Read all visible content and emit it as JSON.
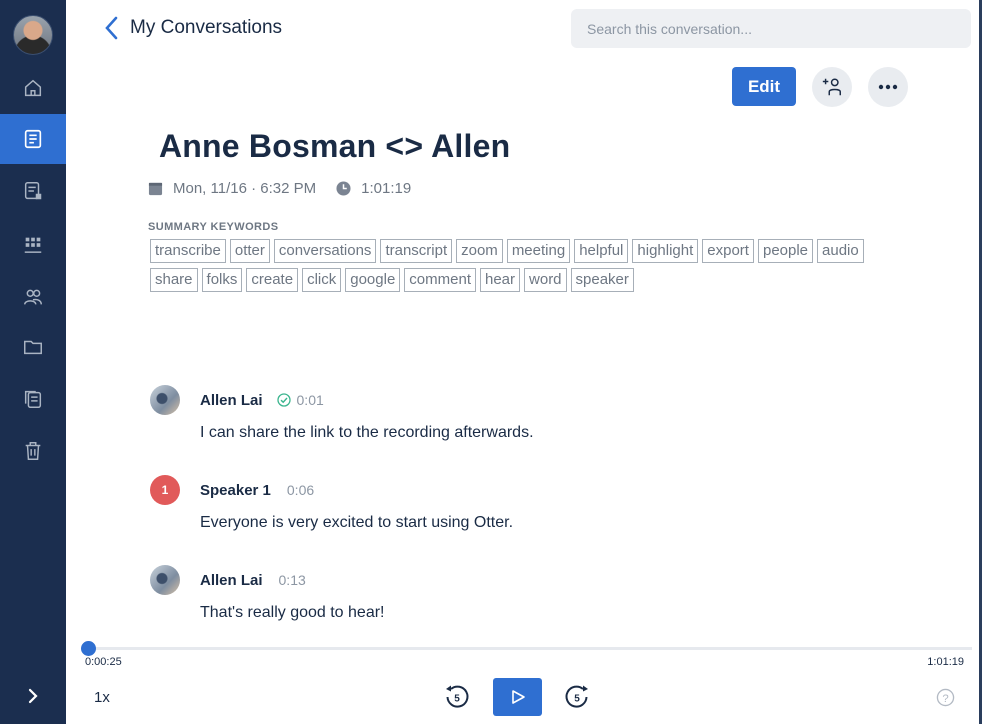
{
  "header": {
    "back_label": "My Conversations",
    "search_placeholder": "Search this conversation..."
  },
  "toolbar": {
    "edit_label": "Edit"
  },
  "conversation": {
    "title": "Anne Bosman <> Allen",
    "date": "Mon, 11/16 · 6:32 PM",
    "duration": "1:01:19"
  },
  "summary": {
    "heading": "SUMMARY KEYWORDS",
    "keywords": [
      "transcribe",
      "otter",
      "conversations",
      "transcript",
      "zoom",
      "meeting",
      "helpful",
      "highlight",
      "export",
      "people",
      "audio",
      "share",
      "folks",
      "create",
      "click",
      "google",
      "comment",
      "hear",
      "word",
      "speaker"
    ]
  },
  "transcript": [
    {
      "speaker": "Allen Lai",
      "time": "0:01",
      "verified": true,
      "text": "I can share the link to the recording afterwards.",
      "avatar": "photo"
    },
    {
      "speaker": "Speaker 1",
      "time": "0:06",
      "verified": false,
      "text": "Everyone is very excited to start using Otter.",
      "avatar": "1"
    },
    {
      "speaker": "Allen Lai",
      "time": "0:13",
      "verified": false,
      "text": "That's really good to hear!",
      "avatar": "photo"
    }
  ],
  "player": {
    "current_time": "0:00:25",
    "total_time": "1:01:19",
    "progress_fraction": 0.0068,
    "speed": "1x",
    "rewind_seconds": "5",
    "forward_seconds": "5"
  },
  "sidebar": {
    "items": [
      "home-icon",
      "conversations-icon",
      "my-notes-icon",
      "apps-icon",
      "groups-icon",
      "folder-icon",
      "shared-icon",
      "trash-icon"
    ],
    "active": "conversations-icon"
  },
  "colors": {
    "accent": "#2f6fd1",
    "sidebar": "#1b2e4f",
    "speaker1": "#e15a5a"
  }
}
